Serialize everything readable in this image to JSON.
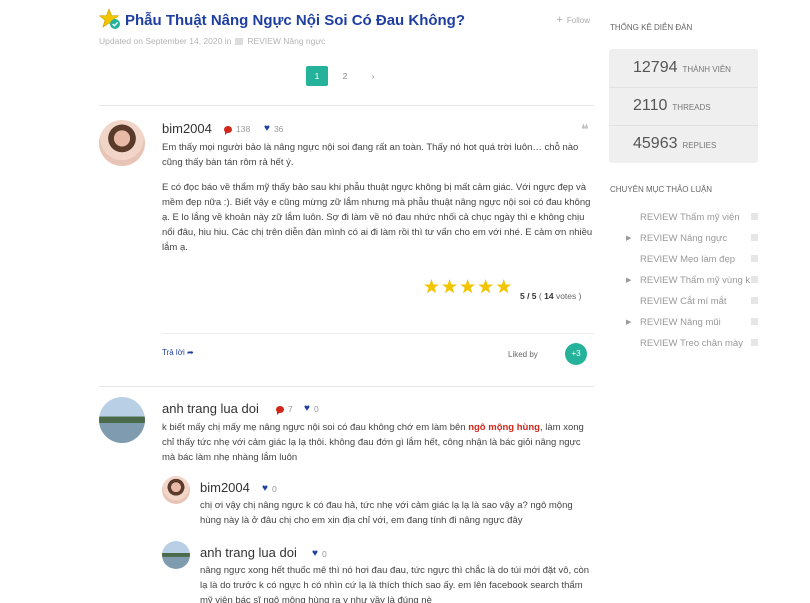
{
  "topic": {
    "title": "Phẫu Thuật Nâng Ngực Nội Soi Có Đau Không?",
    "follow_label": "Follow",
    "updated": "Updated on September 14, 2020 in",
    "category": "REVIEW Nâng ngực"
  },
  "pagination": {
    "pages": [
      "1",
      "2"
    ],
    "next": "›",
    "active": "1"
  },
  "post": {
    "author": "bim2004",
    "comments_count": "138",
    "likes_count": "36",
    "paragraph1": "Em thấy mọi người bảo là nâng ngực nội soi đang rất an toàn. Thấy nó hot quá trời luôn… chỗ nào cũng thấy bàn tán rôm rả hết ý.",
    "paragraph2": "E có đọc báo về thẩm mỹ thấy bảo sau khi phẫu thuật ngực không bị mất cảm giác. Với ngực đẹp và mềm đẹp nữa :). Biết vậy e cũng mừng zữ lắm nhưng mà phẫu thuật nâng ngực nội soi có đau không ạ.  E lo lắng về khoản này zữ lắm luôn. Sợ đi làm về nó đau nhức nhối cả chục ngày thì e không chịu nổi đâu, hiu hiu. Các chị trên diễn đàn mình có ai đi làm rồi thì tư vấn cho em với nhé. E cảm ơn nhiều lắm ạ.",
    "rating_score": "5 / 5",
    "rating_votes": "14",
    "rating_votes_label": "votes",
    "rating_value": 5,
    "reply_label": "Trả lời",
    "liked_by_label": "Liked by",
    "liked_count": "+3"
  },
  "reply1": {
    "author": "anh trang lua doi",
    "comments_count": "7",
    "likes_count": "0",
    "text_before": " k biết mấy chị mấy mẹ nâng ngực nội soi có đau không chớ em làm bên ",
    "text_highlight": "ngô mộng hùng",
    "text_after": ", làm xong chỉ thấy tức nhẹ với cảm giác lạ lạ thôi. không đau đớn gì lắm hết, công nhận là bác giỏi nâng ngực mà bác làm nhẹ nhàng lắm luôn"
  },
  "nested1": {
    "author": "bim2004",
    "likes_count": "0",
    "text": "chị ơi vậy chị nâng ngực k có đau hả, tức nhẹ với cảm giác lạ lạ là sao vậy a? ngô mộng hùng này là ở đâu chị cho em xin địa chỉ với, em đang tính đi nâng ngực đây"
  },
  "nested2": {
    "author": "anh trang lua doi",
    "likes_count": "0",
    "text": "nâng ngực xong hết thuốc mê thì nó hơi đau đau, tức ngực thì chắc là do túi mới đặt vô, còn lạ là do trước k có ngực h có nhìn cứ lạ là thích thích sao ấy. em lên facebook search thẩm mỹ viện bác sĩ ngô mộng hùng ra y như vầy là đúng nè"
  },
  "sidebar": {
    "stats_title": "THỐNG KÊ DIỄN ĐÀN",
    "members_num": "12794",
    "members_label": "THÀNH VIÊN",
    "threads_num": "2110",
    "threads_label": "THREADS",
    "replies_num": "45963",
    "replies_label": "REPLIES",
    "categories_title": "CHUYÊN MỤC THẢO LUẬN",
    "categories": [
      {
        "label": "REVIEW Thẩm mỹ viện",
        "has_arrow": false
      },
      {
        "label": "REVIEW Nâng ngực",
        "has_arrow": true
      },
      {
        "label": "REVIEW Mẹo làm đẹp",
        "has_arrow": false
      },
      {
        "label": "REVIEW Thẩm mỹ vùng kín",
        "has_arrow": true
      },
      {
        "label": "REVIEW Cắt mí mắt",
        "has_arrow": false
      },
      {
        "label": "REVIEW Nâng mũi",
        "has_arrow": true
      },
      {
        "label": "REVIEW Treo chân mày",
        "has_arrow": false
      }
    ]
  },
  "colors": {
    "title_blue": "#1f3fa0",
    "accent_green": "#24b39a",
    "highlight_red": "#d0261b",
    "star_yellow": "#f3c500"
  }
}
